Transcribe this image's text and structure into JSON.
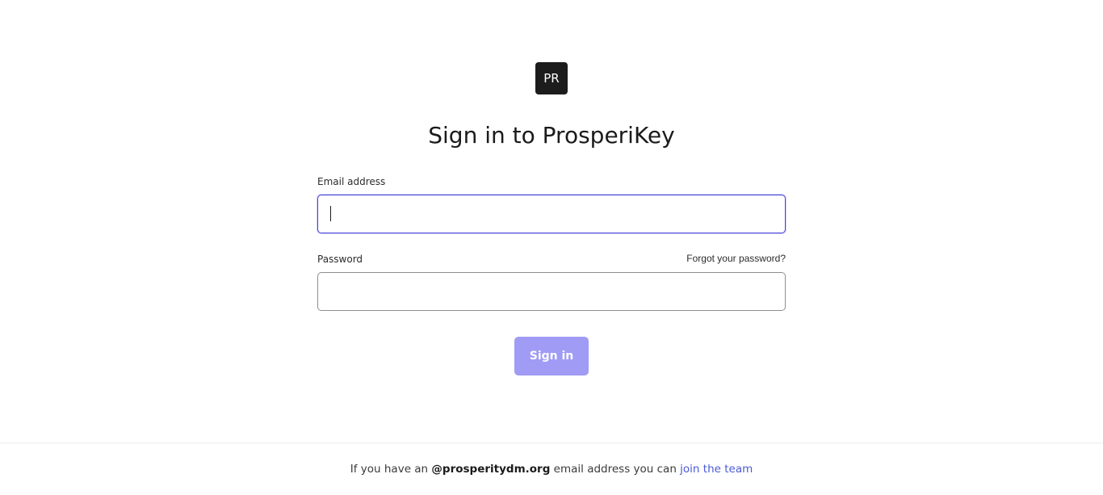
{
  "logo": {
    "initials": "PR"
  },
  "title": "Sign in to ProsperiKey",
  "form": {
    "email_label": "Email address",
    "email_value": "",
    "password_label": "Password",
    "password_value": "",
    "forgot_link": "Forgot your password?",
    "submit_label": "Sign in"
  },
  "footer": {
    "prefix": "If you have an",
    "domain": "@prosperitydm.org",
    "middle": "email address you can",
    "link": "join the team"
  },
  "colors": {
    "accent": "#4a43d8",
    "button_disabled": "#a09cf5",
    "link": "#4a5bd4",
    "logo_bg": "#1c1c1c"
  }
}
